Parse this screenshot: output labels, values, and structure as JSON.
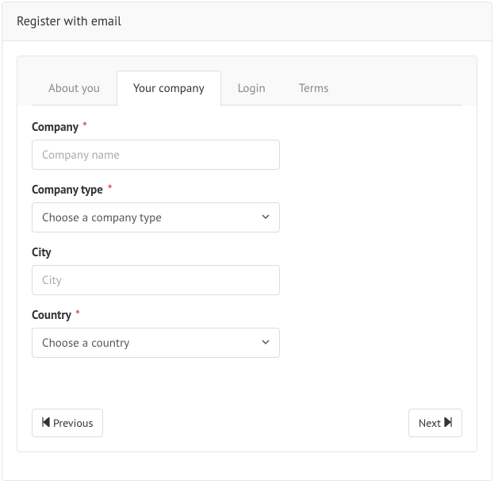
{
  "header": {
    "title": "Register with email"
  },
  "tabs": [
    {
      "label": "About you",
      "active": false
    },
    {
      "label": "Your company",
      "active": true
    },
    {
      "label": "Login",
      "active": false
    },
    {
      "label": "Terms",
      "active": false
    }
  ],
  "fields": {
    "company": {
      "label": "Company",
      "required": true,
      "placeholder": "Company name",
      "value": ""
    },
    "company_type": {
      "label": "Company type",
      "required": true,
      "selected": "Choose a company type"
    },
    "city": {
      "label": "City",
      "required": false,
      "placeholder": "City",
      "value": ""
    },
    "country": {
      "label": "Country",
      "required": true,
      "selected": "Choose a country"
    }
  },
  "footer": {
    "previous": "Previous",
    "next": "Next"
  },
  "asterisk": "*"
}
